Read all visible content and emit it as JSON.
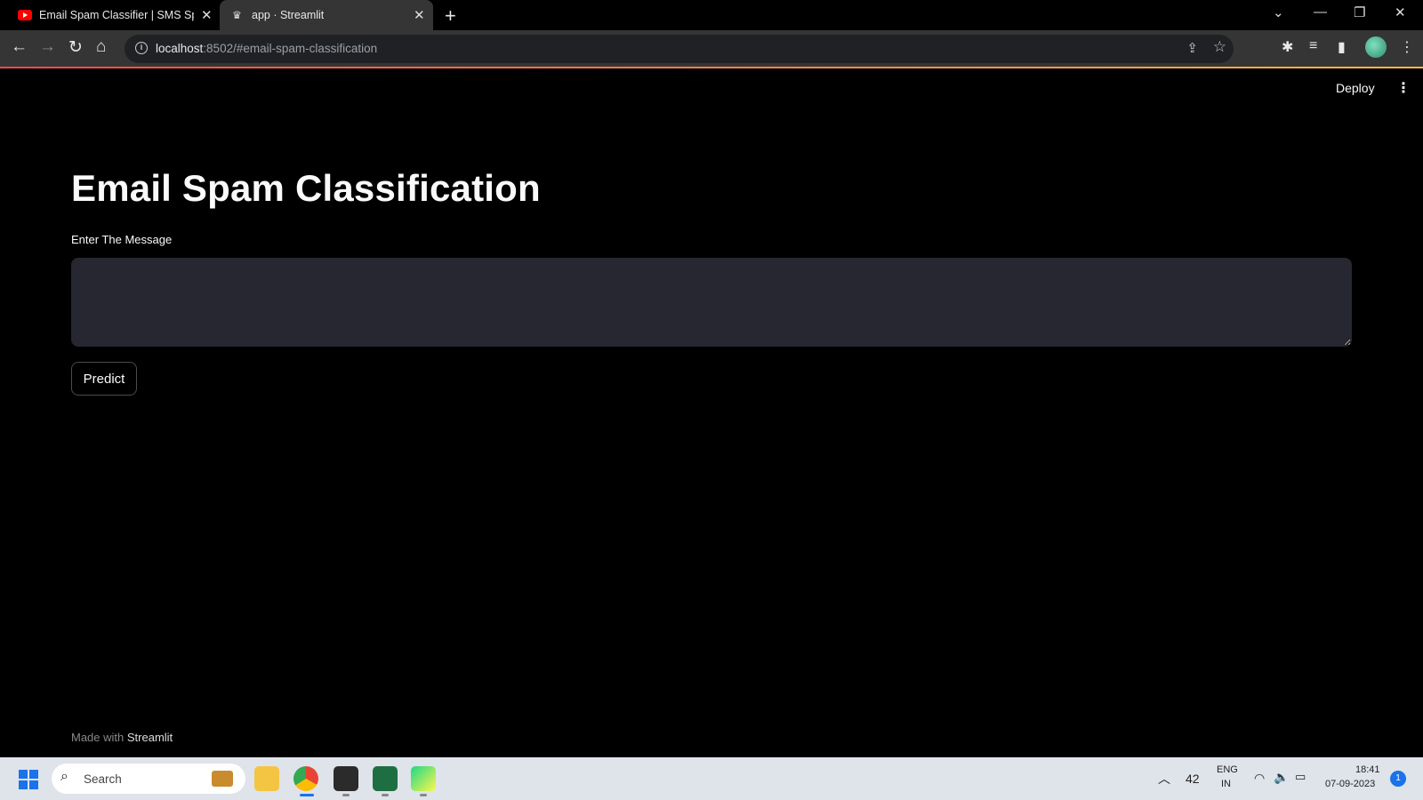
{
  "browser": {
    "tabs": [
      {
        "title": "Email Spam Classifier | SMS Spam",
        "favicon": "youtube-icon",
        "active": false
      },
      {
        "title": "app · Streamlit",
        "favicon": "streamlit-icon",
        "active": true
      }
    ],
    "address": {
      "host": "localhost",
      "path": ":8502/#email-spam-classification"
    }
  },
  "header": {
    "deploy_label": "Deploy"
  },
  "main": {
    "title": "Email Spam Classification",
    "message_label": "Enter The Message",
    "message_value": "",
    "predict_label": "Predict"
  },
  "footer": {
    "made_with": "Made with",
    "brand": "Streamlit"
  },
  "taskbar": {
    "search_placeholder": "Search",
    "temperature": "42",
    "lang_line1": "ENG",
    "lang_line2": "IN",
    "time": "18:41",
    "date": "07-09-2023",
    "notifications": "1"
  },
  "colors": {
    "accent_start": "#ff4b4b",
    "accent_end": "#ffbd45",
    "input_bg": "#262730",
    "page_bg": "#000000"
  }
}
